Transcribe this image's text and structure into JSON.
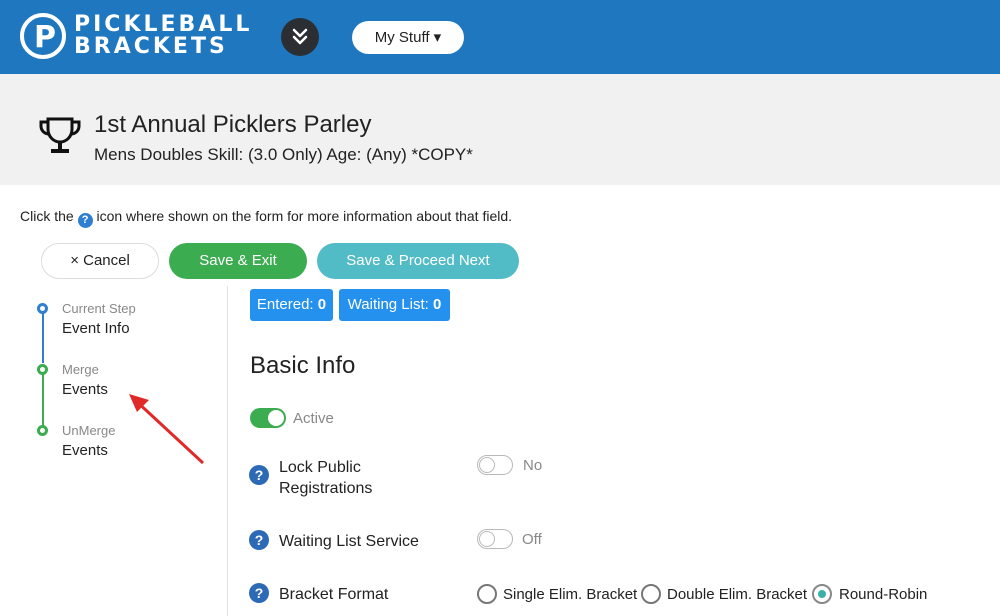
{
  "header": {
    "logo_line1": "PICKLEBALL",
    "logo_line2": "BRACKETS",
    "logo_mark": "P",
    "menu_icon": "double-chevron-down-icon",
    "my_stuff_label": "My Stuff ▾",
    "brand_color": "#1f77c0"
  },
  "event": {
    "title": "1st Annual Picklers Parley",
    "subtitle": "Mens Doubles Skill: (3.0 Only) Age: (Any) *COPY*"
  },
  "help_line": {
    "before": "Click the ",
    "icon": "?",
    "after": " icon where shown on the form for more information about that field."
  },
  "actions": {
    "cancel": "× Cancel",
    "save_exit": "Save & Exit",
    "save_proceed": "Save & Proceed Next"
  },
  "steps": [
    {
      "small": "Current Step",
      "main": "Event Info",
      "color": "#2f7fd1"
    },
    {
      "small": "Merge",
      "main": "Events",
      "color": "#3cac50"
    },
    {
      "small": "UnMerge",
      "main": "Events",
      "color": "#3cac50"
    }
  ],
  "counts": {
    "entered_label": "Entered:",
    "entered_value": "0",
    "waiting_label": "Waiting List:",
    "waiting_value": "0"
  },
  "basic_info": {
    "title": "Basic Info",
    "active_label": "Active",
    "active_on": true,
    "lock_label_1": "Lock Public",
    "lock_label_2": "Registrations",
    "lock_state": "No",
    "waiting_label": "Waiting List Service",
    "waiting_state": "Off",
    "bracket_label": "Bracket Format",
    "bracket_options": [
      "Single Elim. Bracket",
      "Double Elim. Bracket",
      "Round-Robin"
    ],
    "bracket_selected": "Round-Robin",
    "help_icon_text": "?"
  }
}
